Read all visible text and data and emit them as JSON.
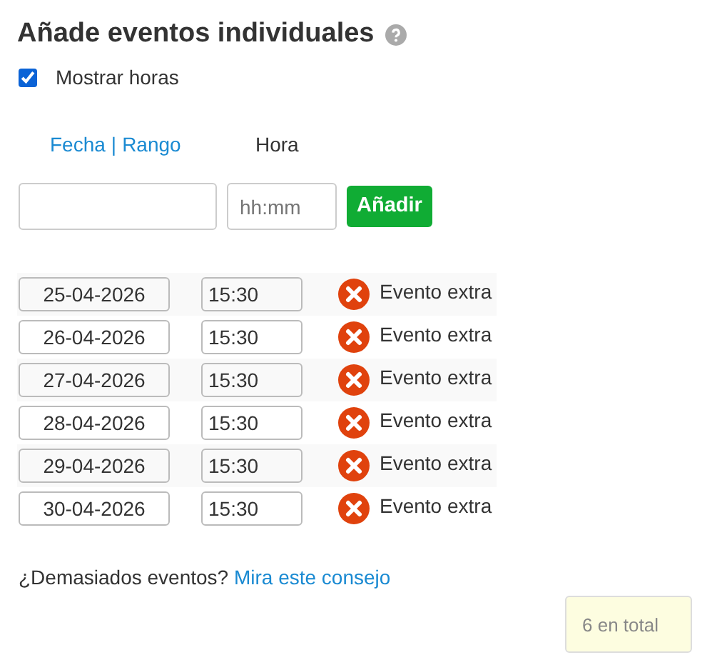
{
  "title": "Añade eventos individuales",
  "show_hours": {
    "label": "Mostrar horas",
    "checked": true
  },
  "mode_links": [
    {
      "label": "Fecha"
    },
    {
      "label": "|"
    },
    {
      "label": "Rango"
    }
  ],
  "time_label": "Hora",
  "new_event": {
    "time_placeholder": "hh:mm",
    "add_button": "Añadir"
  },
  "events": [
    {
      "date": "25-04-2026",
      "time": "15:30",
      "label": "Evento extra"
    },
    {
      "date": "26-04-2026",
      "time": "15:30",
      "label": "Evento extra"
    },
    {
      "date": "27-04-2026",
      "time": "15:30",
      "label": "Evento extra"
    },
    {
      "date": "28-04-2026",
      "time": "15:30",
      "label": "Evento extra"
    },
    {
      "date": "29-04-2026",
      "time": "15:30",
      "label": "Evento extra"
    },
    {
      "date": "30-04-2026",
      "time": "15:30",
      "label": "Evento extra"
    }
  ],
  "tip": {
    "text": "¿Demasiados eventos?",
    "link": "Mira este consejo"
  },
  "total": "6 en total"
}
